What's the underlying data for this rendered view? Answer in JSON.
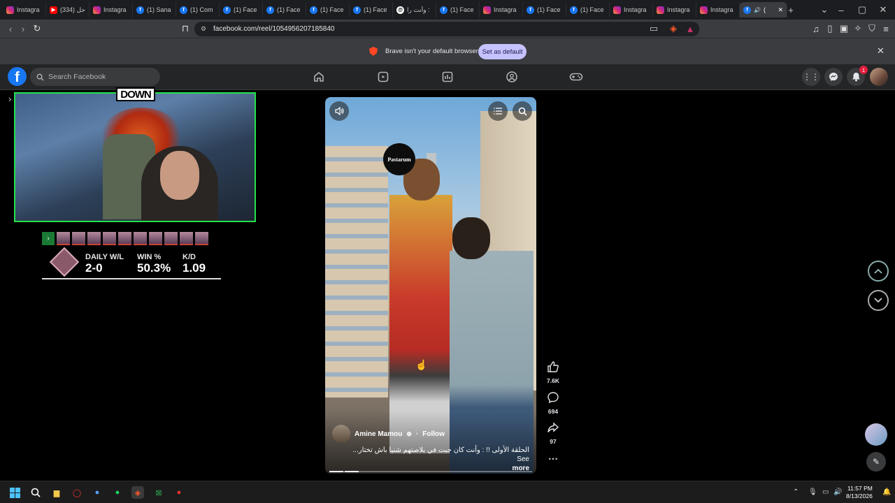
{
  "browser": {
    "tabs": [
      {
        "label": "Instagra",
        "icon": "instagram-icon"
      },
      {
        "label": "(334) حل",
        "icon": "youtube-icon"
      },
      {
        "label": "Instagra",
        "icon": "instagram-icon"
      },
      {
        "label": "(1) Sana",
        "icon": "facebook-icon"
      },
      {
        "label": "(1) Com",
        "icon": "facebook-icon"
      },
      {
        "label": "(1) Face",
        "icon": "facebook-icon"
      },
      {
        "label": "(1) Face",
        "icon": "facebook-icon"
      },
      {
        "label": "(1) Face",
        "icon": "facebook-icon"
      },
      {
        "label": "(1) Face",
        "icon": "facebook-icon"
      },
      {
        "label": "وأنت را :",
        "icon": "threads-icon"
      },
      {
        "label": "(1) Face",
        "icon": "facebook-icon"
      },
      {
        "label": "Instagra",
        "icon": "instagram-icon"
      },
      {
        "label": "(1) Face",
        "icon": "facebook-icon"
      },
      {
        "label": "(1) Face",
        "icon": "facebook-icon"
      },
      {
        "label": "Instagra",
        "icon": "instagram-icon"
      },
      {
        "label": "Instagra",
        "icon": "instagram-icon"
      },
      {
        "label": "Instagra",
        "icon": "instagram-icon"
      },
      {
        "label": "(",
        "icon": "facebook-icon",
        "active": true
      }
    ],
    "url": "facebook.com/reel/1054956207185840",
    "infobar": {
      "message": "Brave isn't your default browser",
      "button": "Set as default"
    }
  },
  "facebook": {
    "search_placeholder": "Search Facebook",
    "notification_count": "1"
  },
  "overlay": {
    "logo_text": "DOWN",
    "stats": [
      {
        "label": "DAILY W/L",
        "value": "2-0"
      },
      {
        "label": "WIN %",
        "value": "50.3%"
      },
      {
        "label": "K/D",
        "value": "1.09"
      }
    ]
  },
  "reel": {
    "sticker": "Pastarum",
    "author": "Amine Mamou",
    "follow": "Follow",
    "caption": "الحلقة الأولى !! : وأنت كان جبت في بلاصتهم شنيا باش تختار... See",
    "see_more": "more",
    "likes": "7.6K",
    "comments": "694",
    "shares": "97"
  },
  "taskbar": {
    "time": "11:57 PM",
    "date": "8/13/2026"
  },
  "colors": {
    "accent": "#1877f2",
    "overlay_green": "#25e24a",
    "set_default_bg": "#c5c2ff"
  }
}
